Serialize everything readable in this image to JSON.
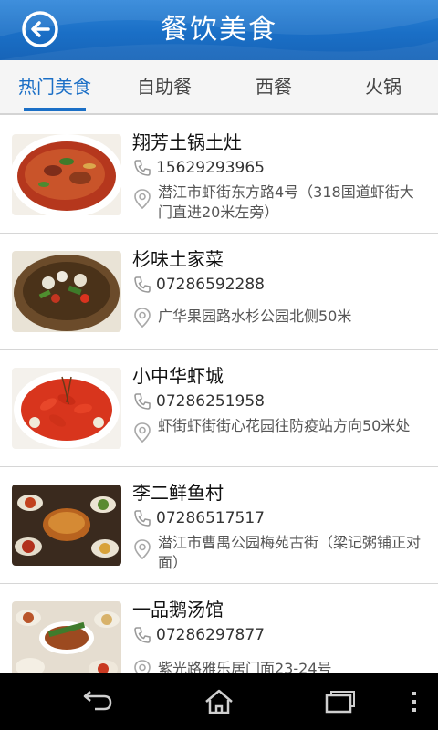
{
  "header": {
    "title": "餐饮美食",
    "back_icon": "back-arrow-icon"
  },
  "tabs": [
    {
      "label": "热门美食",
      "active": true
    },
    {
      "label": "自助餐",
      "active": false
    },
    {
      "label": "西餐",
      "active": false
    },
    {
      "label": "火锅",
      "active": false
    }
  ],
  "restaurants": [
    {
      "name": "翔芳土锅土灶",
      "phone": "15629293965",
      "address": "潜江市虾街东方路4号（318国道虾街大门直进20米左旁）"
    },
    {
      "name": "杉味土家菜",
      "phone": "07286592288",
      "address": "广华果园路水杉公园北侧50米"
    },
    {
      "name": "小中华虾城",
      "phone": "07286251958",
      "address": "虾街虾街街心花园往防疫站方向50米处"
    },
    {
      "name": "李二鲜鱼村",
      "phone": "07286517517",
      "address": "潜江市曹禺公园梅苑古街（梁记粥铺正对面）"
    },
    {
      "name": "一品鹅汤馆",
      "phone": "07286297877",
      "address": "紫光路雅乐居门面23-24号"
    }
  ],
  "navbar": {
    "icons": [
      "back-nav-icon",
      "home-icon",
      "recent-apps-icon",
      "more-menu-icon"
    ]
  },
  "colors": {
    "header_blue": "#1b6fc6",
    "active_tab": "#1b6fc6"
  }
}
